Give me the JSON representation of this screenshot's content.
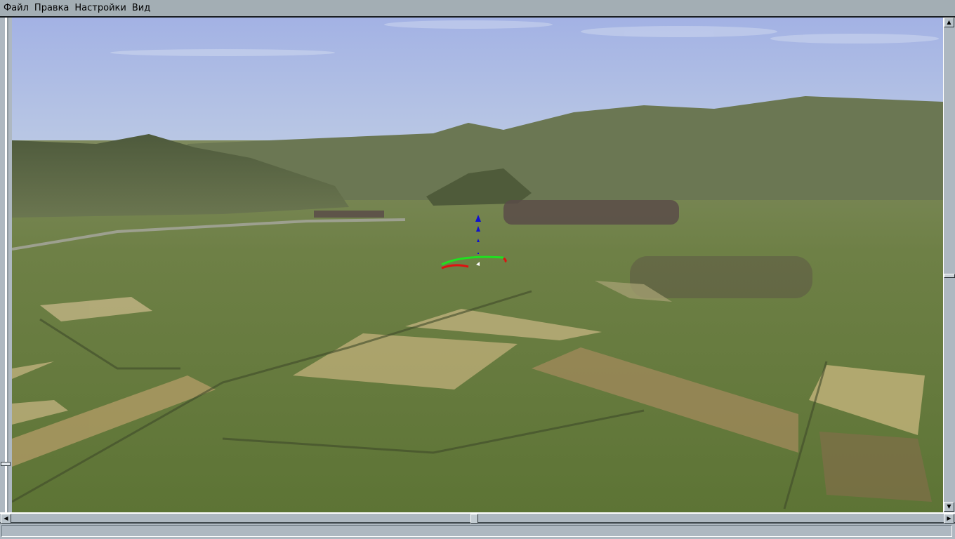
{
  "menu": {
    "items": [
      {
        "label": "Файл"
      },
      {
        "label": "Правка"
      },
      {
        "label": "Настройки"
      },
      {
        "label": "Вид"
      }
    ]
  },
  "scrollbars": {
    "up_arrow": "▲",
    "down_arrow": "▼",
    "left_arrow": "◀",
    "right_arrow": "▶"
  },
  "status": {
    "text": ""
  },
  "colors": {
    "sky_top": "#a6b4e6",
    "sky_bottom": "#b9c7e6",
    "gizmo_x": "#e01010",
    "gizmo_y": "#20e020",
    "gizmo_z": "#1010d0"
  }
}
